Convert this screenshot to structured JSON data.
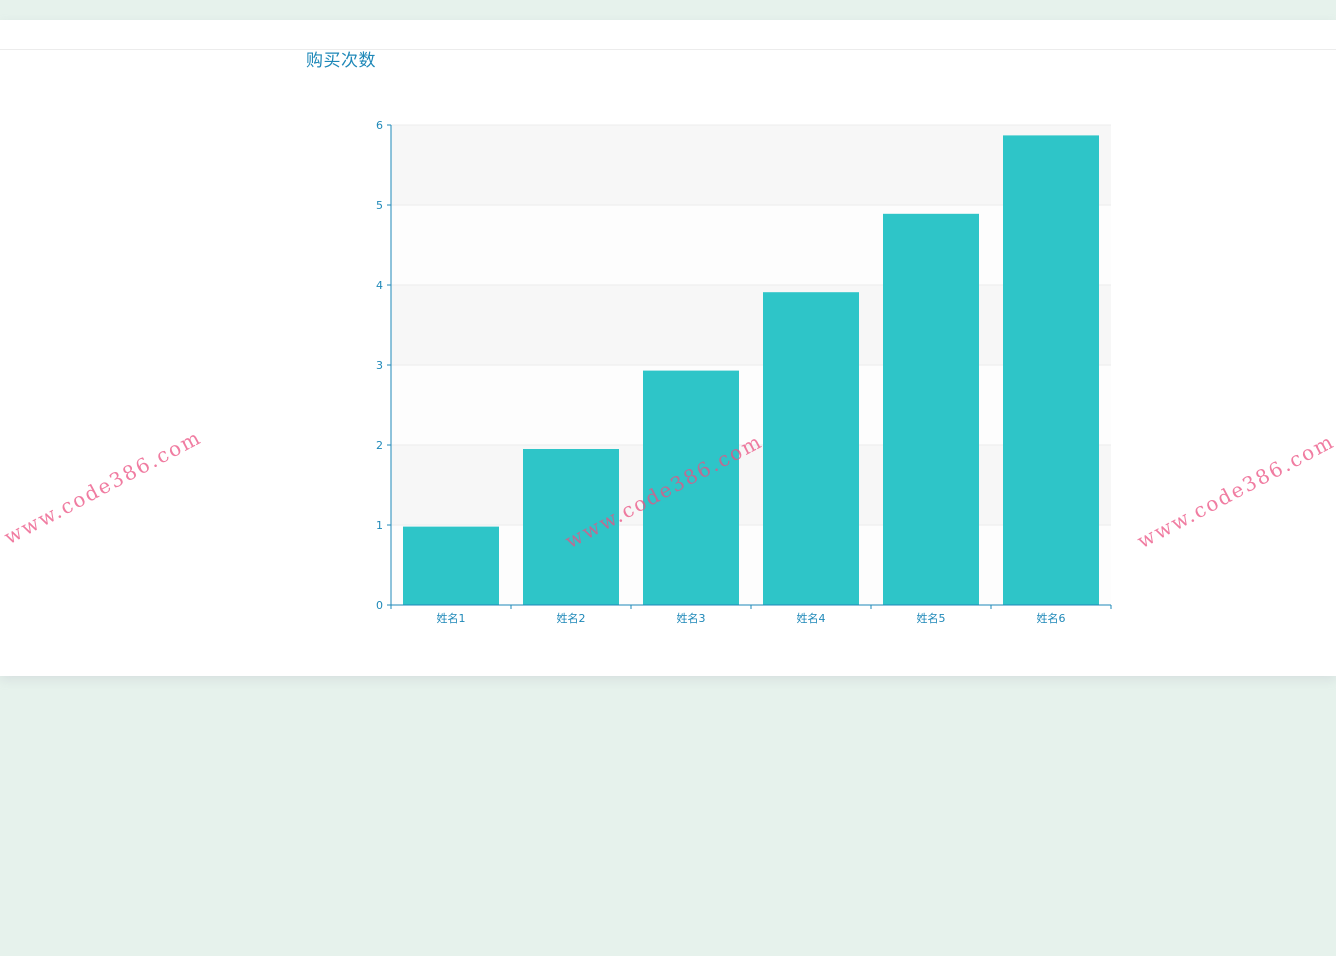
{
  "title": "购买次数",
  "watermark_text": "www.code386.com",
  "colors": {
    "bar": "#2ec5c8",
    "axis": "#1e88b8",
    "band_dark": "#f7f7f7",
    "band_light": "#fdfdfd",
    "background": "#e6f2ec"
  },
  "chart_data": {
    "type": "bar",
    "title": "购买次数",
    "categories": [
      "姓名1",
      "姓名2",
      "姓名3",
      "姓名4",
      "姓名5",
      "姓名6"
    ],
    "values": [
      0.98,
      1.95,
      2.93,
      3.91,
      4.89,
      5.87
    ],
    "y_ticks": [
      "0",
      "1",
      "2",
      "3",
      "4",
      "5",
      "6"
    ],
    "ylim": [
      0,
      6
    ],
    "xlabel": "",
    "ylabel": "",
    "grid": true
  }
}
